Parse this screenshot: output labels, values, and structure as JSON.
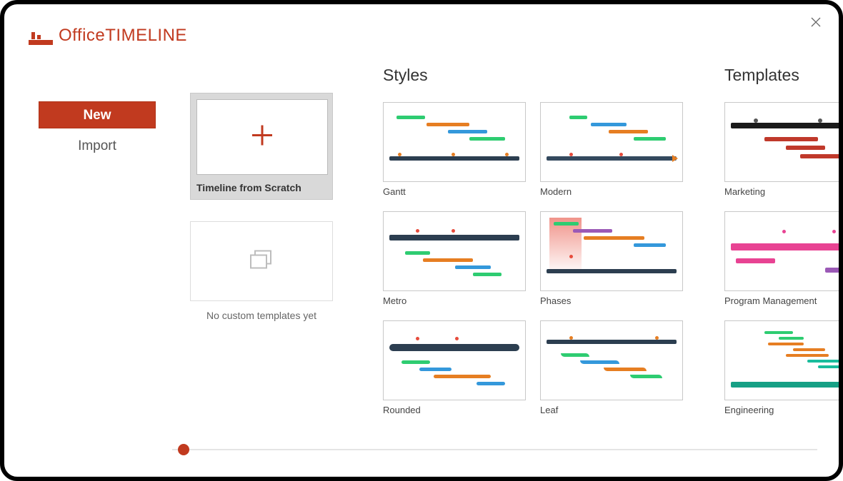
{
  "app": {
    "name_part1": "Office",
    "name_part2": "TIMELINE"
  },
  "sidebar": {
    "new_label": "New",
    "import_label": "Import"
  },
  "scratch": {
    "card_label": "Timeline from Scratch",
    "custom_label": "No custom templates yet"
  },
  "sections": {
    "styles_title": "Styles",
    "templates_title": "Templates"
  },
  "styles": [
    {
      "label": "Gantt"
    },
    {
      "label": "Modern"
    },
    {
      "label": "Metro"
    },
    {
      "label": "Phases"
    },
    {
      "label": "Rounded"
    },
    {
      "label": "Leaf"
    }
  ],
  "templates": [
    {
      "label": "Marketing"
    },
    {
      "label": "Program Management"
    },
    {
      "label": "Engineering"
    }
  ],
  "colors": {
    "brand": "#c13a1f",
    "dark": "#2c3e50",
    "green": "#2ecc71",
    "blue": "#3498db",
    "orange": "#e67e22",
    "red": "#e74c3c",
    "purple": "#9b59b6",
    "teal": "#1abc9c",
    "pink": "#e84393"
  }
}
